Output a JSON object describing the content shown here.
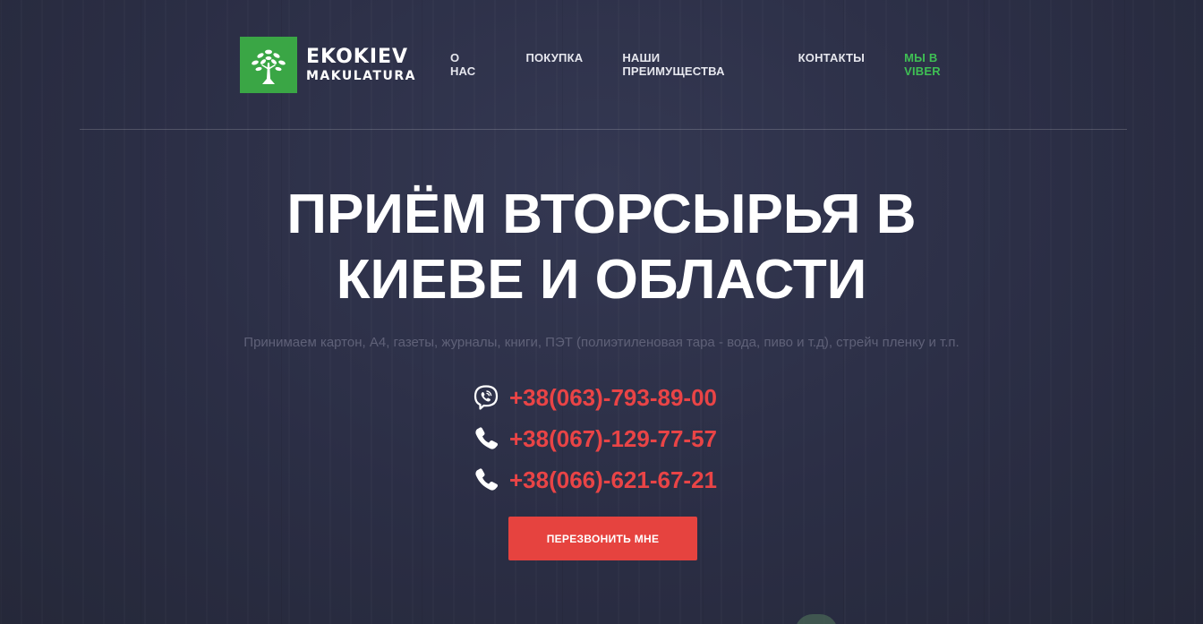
{
  "header": {
    "logo": {
      "line1": "EKOKIEV",
      "line2": "MAKULATURA",
      "icon": "tree-icon",
      "color": "#3aa645"
    },
    "nav": [
      {
        "label": "О НАС"
      },
      {
        "label": "ПОКУПКА"
      },
      {
        "label": "НАШИ ПРЕИМУЩЕСТВА"
      },
      {
        "label": "КОНТАКТЫ"
      },
      {
        "label": "МЫ В VIBER",
        "color": "#3fbf54"
      }
    ]
  },
  "hero": {
    "title": "ПРИЁМ ВТОРСЫРЬЯ В\nКИЕВЕ И ОБЛАСТИ",
    "subtitle": "Принимаем картон, А4, газеты, журналы, книги, ПЭТ (полиэтиленовая тара - вода, пиво и т.д), стрейч пленку и т.п."
  },
  "phones": [
    {
      "number": "+38(063)-793-89-00",
      "icon": "viber-icon"
    },
    {
      "number": "+38(067)-129-77-57",
      "icon": "phone-icon"
    },
    {
      "number": "+38(066)-621-67-21",
      "icon": "phone-icon"
    }
  ],
  "cta": {
    "label": "ПЕРЕЗВОНИТЬ МНЕ",
    "color": "#e6433f"
  },
  "colors": {
    "background": "#2d3048",
    "accent_red": "#e94446",
    "accent_green": "#3fbf54"
  }
}
